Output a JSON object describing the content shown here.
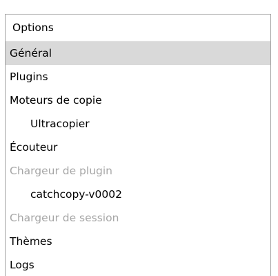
{
  "panel": {
    "header": "Options",
    "items": [
      {
        "label": "Général",
        "level": 0,
        "state": "selected"
      },
      {
        "label": "Plugins",
        "level": 0,
        "state": "normal"
      },
      {
        "label": "Moteurs de copie",
        "level": 0,
        "state": "normal"
      },
      {
        "label": "Ultracopier",
        "level": 1,
        "state": "normal"
      },
      {
        "label": "Écouteur",
        "level": 0,
        "state": "normal"
      },
      {
        "label": "Chargeur de plugin",
        "level": 0,
        "state": "disabled"
      },
      {
        "label": "catchcopy-v0002",
        "level": 1,
        "state": "normal"
      },
      {
        "label": "Chargeur de session",
        "level": 0,
        "state": "disabled"
      },
      {
        "label": "Thèmes",
        "level": 0,
        "state": "normal"
      },
      {
        "label": "Logs",
        "level": 0,
        "state": "normal"
      }
    ]
  },
  "colors": {
    "selected_background": "#d9d9d9",
    "disabled_text": "#a6a6a6",
    "border": "#a0a0a0"
  }
}
